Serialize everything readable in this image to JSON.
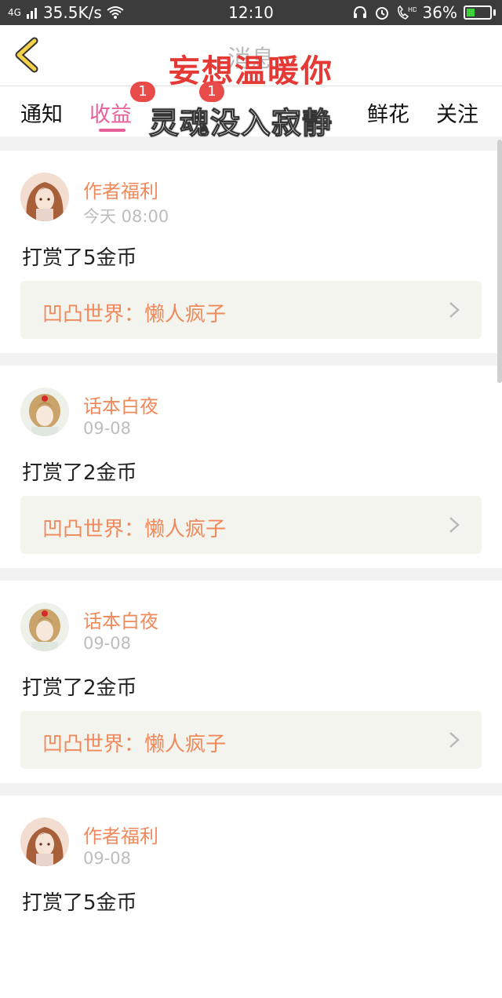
{
  "status_bar": {
    "network": "4G",
    "speed": "35.5K/s",
    "time": "12:10",
    "battery": "36%",
    "battery_level": 0.36
  },
  "nav": {
    "title": "消息",
    "overlay_text": "妄想温暖你"
  },
  "tabs": [
    {
      "label": "通知"
    },
    {
      "label": "收益",
      "badge": "1"
    },
    {
      "label": "",
      "badge": "1"
    },
    {
      "label": "鲜花"
    },
    {
      "label": "关注"
    }
  ],
  "tabs_overlay_text": "灵魂没入寂静",
  "feed": [
    {
      "sender": "作者福利",
      "time": "今天 08:00",
      "message": "打赏了5金币",
      "link": "凹凸世界：懒人疯子"
    },
    {
      "sender": "话本白夜",
      "time": "09-08",
      "message": "打赏了2金币",
      "link": "凹凸世界：懒人疯子"
    },
    {
      "sender": "话本白夜",
      "time": "09-08",
      "message": "打赏了2金币",
      "link": "凹凸世界：懒人疯子"
    },
    {
      "sender": "作者福利",
      "time": "09-08",
      "message": "打赏了5金币",
      "link": ""
    }
  ],
  "colors": {
    "accent": "#e7609a",
    "sender": "#f08a5c",
    "badge": "#e94b4b",
    "overlay_red": "#e53935"
  }
}
